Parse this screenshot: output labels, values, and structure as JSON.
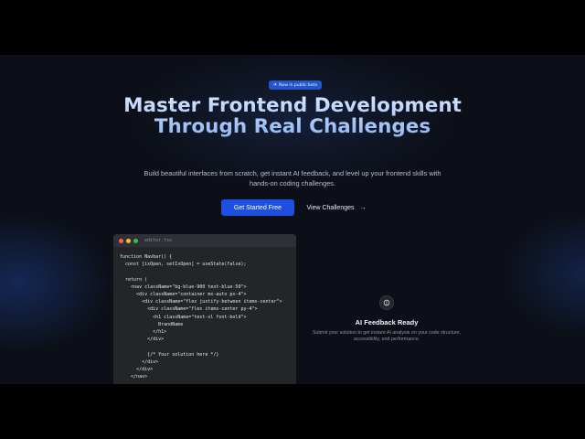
{
  "badge": {
    "icon": "rocket-icon",
    "label": "Now in public beta"
  },
  "hero": {
    "title": "Master Frontend Development Through Real Challenges",
    "subtitle": "Build beautiful interfaces from scratch, get instant AI feedback, and level up your frontend skills with hands-on coding challenges."
  },
  "actions": {
    "primary_label": "Get Started Free",
    "secondary_label": "View Challenges",
    "secondary_icon": "arrow-right-icon"
  },
  "editor": {
    "filename": "editor.tsx",
    "code": "function Navbar() {\n  const [isOpen, setIsOpen] = useState(false);\n\n  return (\n    <nav className=\"bg-blue-900 text-blue-50\">\n      <div className=\"container mx-auto px-4\">\n        <div className=\"flex justify-between items-center\">\n          <div className=\"flex items-center py-4\">\n            <h1 className=\"text-xl font-bold\">\n              BrandName\n            </h1>\n          </div>\n\n          {/* Your solution here */}\n        </div>\n      </div>\n    </nav>"
  },
  "feedback": {
    "icon": "brain-icon",
    "title": "AI Feedback Ready",
    "description": "Submit your solution to get instant AI analysis on your code structure, accessibility, and performance."
  },
  "colors": {
    "accent": "#1f4fe0",
    "badge": "#2356c9",
    "background": "#0c0f17"
  }
}
